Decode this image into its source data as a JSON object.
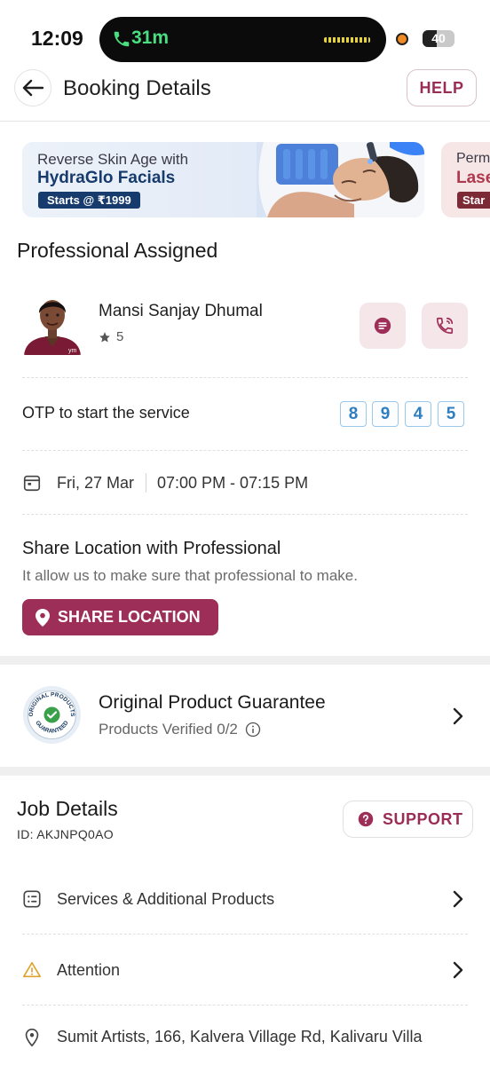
{
  "status_bar": {
    "time": "12:09",
    "call_duration": "31m",
    "battery": "40"
  },
  "header": {
    "title": "Booking Details",
    "help_label": "HELP"
  },
  "banners": [
    {
      "line1": "Reverse Skin Age with",
      "line2": "HydraGlo Facials",
      "price": "Starts @ ₹1999",
      "accent": "#173b6c"
    },
    {
      "line1": "Perm",
      "line2": "Lase",
      "price": "Star",
      "accent": "#b0384f"
    }
  ],
  "professional": {
    "section_title": "Professional Assigned",
    "name": "Mansi Sanjay Dhumal",
    "rating": "5",
    "photo_caption": "ym"
  },
  "otp": {
    "label": "OTP to start the service",
    "digits": [
      "8",
      "9",
      "4",
      "5"
    ]
  },
  "schedule": {
    "date": "Fri, 27 Mar",
    "time": "07:00 PM - 07:15 PM"
  },
  "share_location": {
    "title": "Share Location with Professional",
    "subtitle": "It allow us to make sure that professional to make.",
    "button_label": "SHARE LOCATION"
  },
  "guarantee": {
    "title": "Original Product Guarantee",
    "subtitle": "Products Verified 0/2",
    "badge_top": "ORIGINAL PRODUCTS",
    "badge_bottom": "GUARANTEED"
  },
  "job": {
    "title": "Job Details",
    "id": "ID: AKJNPQ0AO",
    "support_label": "SUPPORT",
    "rows": [
      {
        "label": "Services & Additional Products",
        "icon": "list-icon"
      },
      {
        "label": "Attention",
        "icon": "warning-icon"
      },
      {
        "label": "Sumit Artists, 166, Kalvera Village Rd, Kalivaru Villa",
        "icon": "location-pin-icon"
      }
    ]
  },
  "colors": {
    "brand": "#9d2e58",
    "otp_blue": "#2f7fc0",
    "help_text": "#9a2d55"
  }
}
